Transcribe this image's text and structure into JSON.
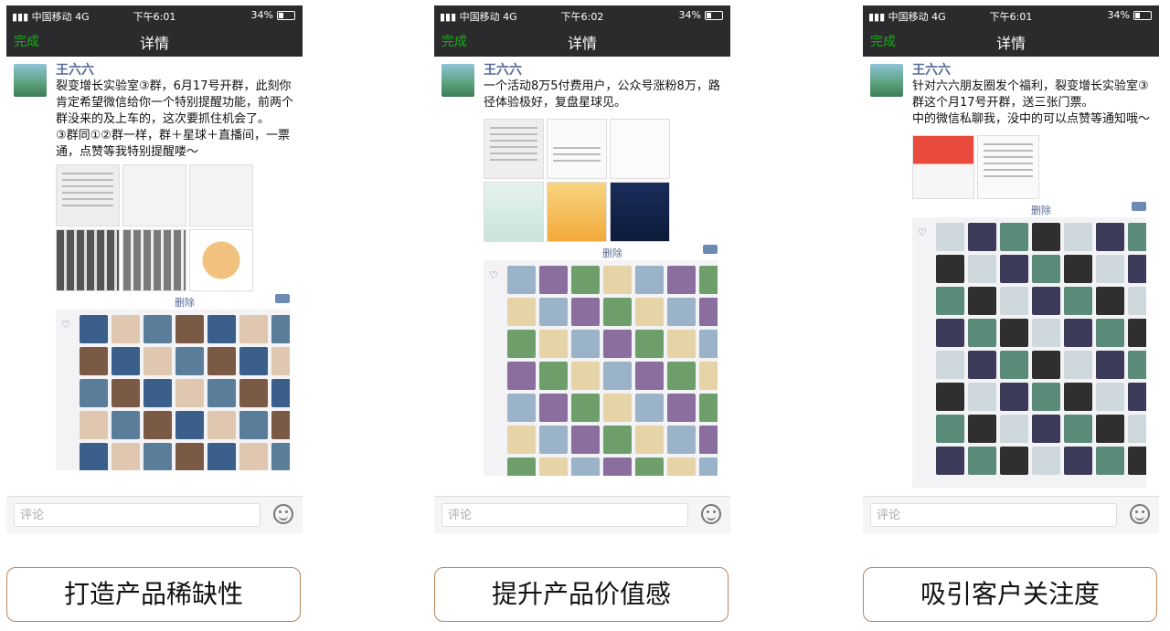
{
  "phones": [
    {
      "status": {
        "carrier": "中国移动",
        "network": "4G",
        "time": "下午6:01",
        "battery": "34%"
      },
      "nav": {
        "done": "完成",
        "title": "详情"
      },
      "author": "王六六",
      "text": "裂变增长实验室③群，6月17号开群，此刻你肯定希望微信给你一个特别提醒功能，前两个群没来的及上车的，这次要抓住机会了。\n③群同①②群一样，群＋星球＋直播间，一票通，点赞等我特别提醒喽～",
      "delete": "删除",
      "comment_placeholder": "评论",
      "caption": "打造产品稀缺性"
    },
    {
      "status": {
        "carrier": "中国移动",
        "network": "4G",
        "time": "下午6:02",
        "battery": "34%"
      },
      "nav": {
        "done": "完成",
        "title": "详情"
      },
      "author": "王六六",
      "text": "一个活动8万5付费用户，公众号涨粉8万，路径体验极好，复盘星球见。",
      "delete": "删除",
      "comment_placeholder": "评论",
      "caption": "提升产品价值感"
    },
    {
      "status": {
        "carrier": "中国移动",
        "network": "4G",
        "time": "下午6:01",
        "battery": "34%"
      },
      "nav": {
        "done": "完成",
        "title": "详情"
      },
      "author": "王六六",
      "text": "针对六六朋友圈发个福利，裂变增长实验室③群这个月17号开群，送三张门票。\n中的微信私聊我，没中的可以点赞等通知哦～",
      "delete": "删除",
      "comment_placeholder": "评论",
      "caption": "吸引客户关注度"
    }
  ],
  "avatar_colors": [
    "#3a5f8a",
    "#c9a27a",
    "#6b4f3a",
    "#d9d2c0",
    "#2f2f2f",
    "#9bb3c8",
    "#7a8f5a",
    "#e0c8b0",
    "#4d6b7f",
    "#a85d4a",
    "#1f3a2f",
    "#cfd8dc",
    "#8a6f9e",
    "#e8b04a",
    "#5a7d9a",
    "#2e4e3f",
    "#b0895a",
    "#d6c7e0",
    "#3c3c5a",
    "#6e9f6b",
    "#f0e0c8",
    "#7b5a45",
    "#9fc0d8",
    "#404040",
    "#c27b62",
    "#5b8c7a",
    "#e6d3a8",
    "#2d5d8a"
  ]
}
